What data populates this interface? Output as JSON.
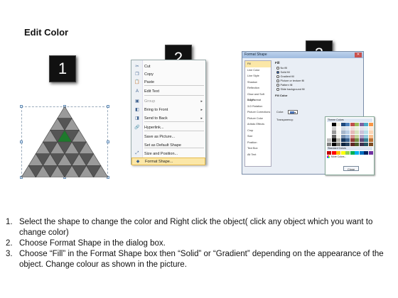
{
  "title": "Edit Color",
  "steps": {
    "one": "1",
    "two": "2",
    "three": "3"
  },
  "context_menu": {
    "items": [
      {
        "label": "Cut",
        "icon": "scissors-icon",
        "disabled": false
      },
      {
        "label": "Copy",
        "icon": "copy-icon",
        "disabled": false
      },
      {
        "label": "Paste",
        "icon": "paste-icon",
        "disabled": false
      },
      {
        "label": "Edit Text",
        "icon": "edit-text-icon",
        "disabled": false
      },
      {
        "label": "Group",
        "icon": "group-icon",
        "disabled": true
      },
      {
        "label": "Bring to Front",
        "icon": "bring-front-icon",
        "disabled": false
      },
      {
        "label": "Send to Back",
        "icon": "send-back-icon",
        "disabled": false
      },
      {
        "label": "Hyperlink...",
        "icon": "hyperlink-icon",
        "disabled": false
      },
      {
        "label": "Save as Picture...",
        "icon": "",
        "disabled": false
      },
      {
        "label": "Set as Default Shape",
        "icon": "",
        "disabled": false
      },
      {
        "label": "Size and Position...",
        "icon": "size-position-icon",
        "disabled": false
      },
      {
        "label": "Format Shape...",
        "icon": "format-shape-icon",
        "disabled": false
      }
    ]
  },
  "dialog": {
    "title": "Format Shape",
    "left_items": [
      "Fill",
      "Line Color",
      "Line Style",
      "Shadow",
      "Reflection",
      "Glow and Soft Edges",
      "3-D Format",
      "3-D Rotation",
      "Picture Corrections",
      "Picture Color",
      "Artistic Effects",
      "Crop",
      "Size",
      "Position",
      "Text Box",
      "Alt Text"
    ],
    "section": "Fill",
    "options": [
      "No fill",
      "Solid fill",
      "Gradient fill",
      "Picture or texture fill",
      "Pattern fill",
      "Slide background fill"
    ],
    "selected_option": "Solid fill",
    "fill_color_label": "Fill Color",
    "color_label": "Color:",
    "transparency_label": "Transparency:",
    "theme_colors_label": "Theme Colors",
    "standard_colors_label": "Standard Colors",
    "more_colors_label": "More Colors...",
    "close_label": "Close"
  },
  "instructions": [
    {
      "num": "1.",
      "text": "Select the shape to change the color and Right click the object( click any object which you want to change color)"
    },
    {
      "num": "2.",
      "text": "Choose Format Shape in the dialog box."
    },
    {
      "num": "3.",
      "text": "Choose “Fill” in the Format Shape box then “Solid” or “Gradient” depending on the appearance of the object. Change colour as shown in the picture."
    }
  ],
  "colors": {
    "pyramid_dark": "#555555",
    "pyramid_light": "#9a9a9a",
    "highlight": "#1e7a2c",
    "menu_highlight": "#fbe7a7"
  }
}
